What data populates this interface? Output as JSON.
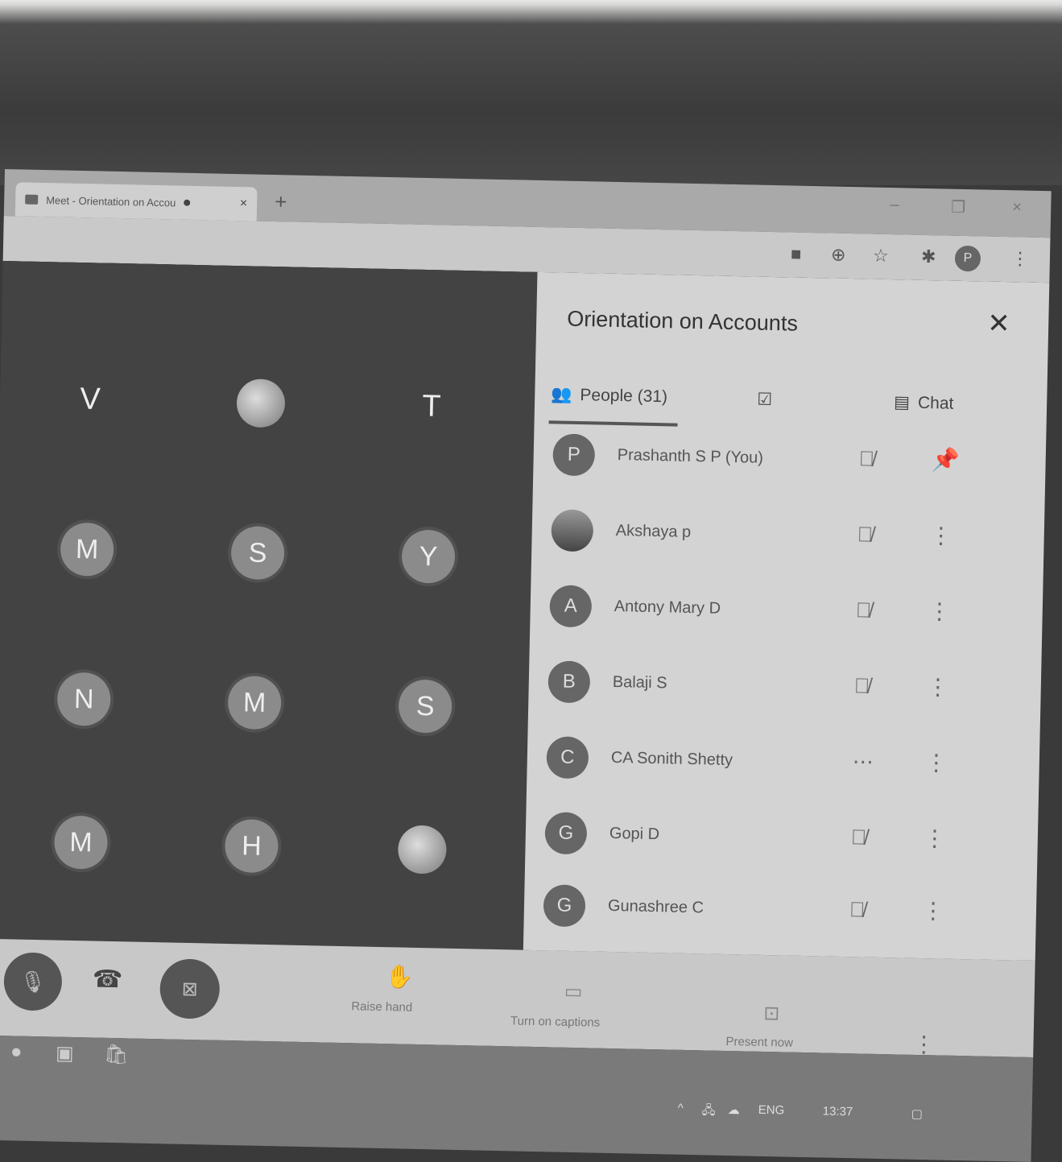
{
  "browser": {
    "tab_title": "Meet - Orientation on Accou",
    "tab_close": "×",
    "new_tab": "+",
    "window_minimize": "–",
    "window_restore": "❐",
    "window_close": "×"
  },
  "grid": {
    "tiles": [
      {
        "label": "V",
        "kind": "letter"
      },
      {
        "label": "",
        "kind": "photo"
      },
      {
        "label": "T",
        "kind": "letter"
      },
      {
        "label": "M",
        "kind": "avatar"
      },
      {
        "label": "S",
        "kind": "avatar"
      },
      {
        "label": "Y",
        "kind": "avatar"
      },
      {
        "label": "N",
        "kind": "avatar"
      },
      {
        "label": "M",
        "kind": "avatar"
      },
      {
        "label": "S",
        "kind": "avatar"
      },
      {
        "label": "M",
        "kind": "avatar"
      },
      {
        "label": "H",
        "kind": "avatar"
      },
      {
        "label": "",
        "kind": "photo"
      }
    ]
  },
  "panel": {
    "title": "Orientation on Accounts",
    "close": "✕",
    "people_tab": "People (31)",
    "chat_tab": "Chat",
    "participants": [
      {
        "initial": "P",
        "name": "Prashanth S P (You)",
        "action": "pin-icon"
      },
      {
        "initial": "",
        "name": "Akshaya p",
        "action": "more-icon"
      },
      {
        "initial": "A",
        "name": "Antony Mary D",
        "action": "more-icon"
      },
      {
        "initial": "B",
        "name": "Balaji S",
        "action": "more-icon"
      },
      {
        "initial": "C",
        "name": "CA Sonith Shetty",
        "action": "more-icon"
      },
      {
        "initial": "G",
        "name": "Gopi D",
        "action": "more-icon"
      },
      {
        "initial": "G",
        "name": "Gunashree C",
        "action": "more-icon"
      }
    ]
  },
  "controls": {
    "raise_hand": "Raise hand",
    "captions": "Turn on captions",
    "present": "Present now"
  },
  "taskbar": {
    "language": "ENG",
    "time": "13:37"
  }
}
